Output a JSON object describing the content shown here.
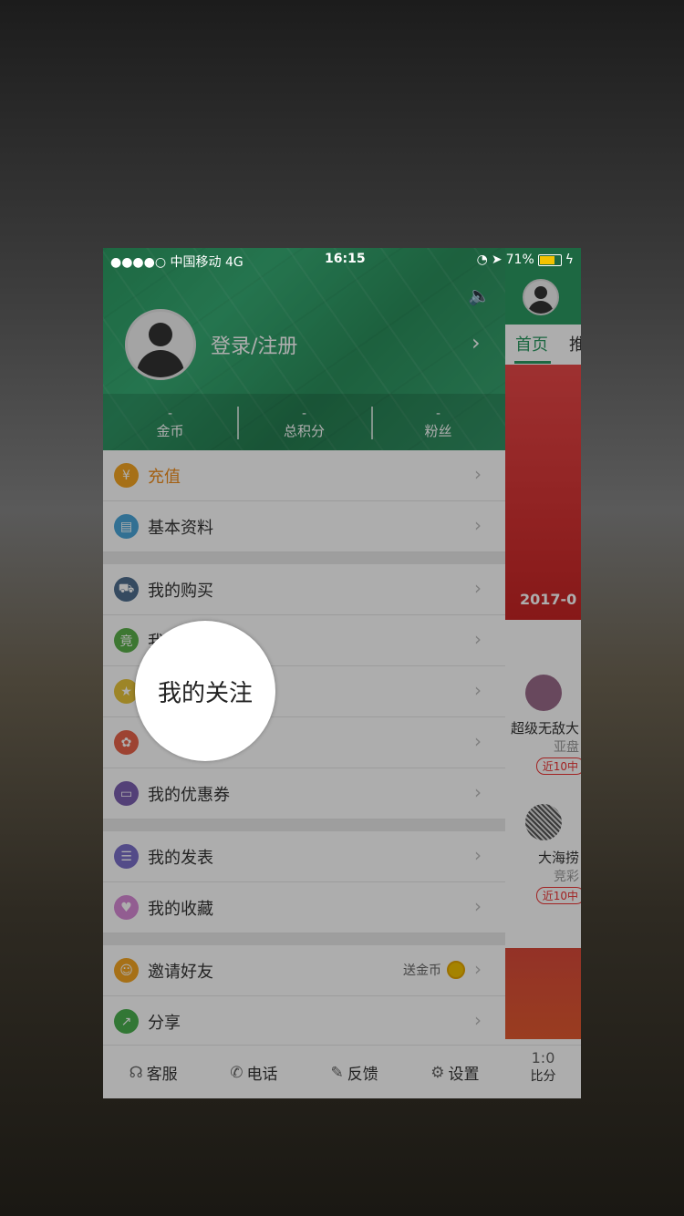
{
  "status_bar": {
    "carrier": "●●●●○ 中国移动 4G",
    "time": "16:15",
    "battery": "71%"
  },
  "drawer": {
    "login_label": "登录/注册",
    "stats": [
      {
        "value": "-",
        "label": "金币"
      },
      {
        "value": "-",
        "label": "总积分"
      },
      {
        "value": "-",
        "label": "粉丝"
      }
    ],
    "groups": [
      [
        {
          "label": "充值",
          "icon": "yen-icon",
          "color": "#f5a623"
        },
        {
          "label": "基本资料",
          "icon": "profile-card-icon",
          "color": "#4aa6d9"
        }
      ],
      [
        {
          "label": "我的购买",
          "icon": "cart-icon",
          "color": "#4f6e8e"
        },
        {
          "label": "我",
          "icon": "ticket-icon",
          "color": "#5ab04a"
        },
        {
          "label": "",
          "icon": "star-icon",
          "color": "#e8c53a"
        },
        {
          "label": "",
          "icon": "gift-icon",
          "color": "#e8644b"
        },
        {
          "label": "我的优惠券",
          "icon": "coupon-icon",
          "color": "#7b5fb0"
        }
      ],
      [
        {
          "label": "我的发表",
          "icon": "post-icon",
          "color": "#7b6fc9"
        },
        {
          "label": "我的收藏",
          "icon": "heart-icon",
          "color": "#d78ad6"
        }
      ],
      [
        {
          "label": "邀请好友",
          "icon": "invite-icon",
          "color": "#f5a623",
          "extra": "送金币"
        },
        {
          "label": "分享",
          "icon": "share-icon",
          "color": "#4ab04f"
        }
      ]
    ],
    "bottom": [
      {
        "label": "客服",
        "icon": "headset-icon"
      },
      {
        "label": "电话",
        "icon": "phone-icon"
      },
      {
        "label": "反馈",
        "icon": "edit-icon"
      },
      {
        "label": "设置",
        "icon": "gear-icon"
      }
    ]
  },
  "strip": {
    "tab_home": "首页",
    "tab_next": "推",
    "banner_date": "2017-0",
    "cards": [
      {
        "name": "超级无敌大",
        "sub": "亚盘",
        "badge": "近10中"
      },
      {
        "name": "大海捞",
        "sub": "竞彩",
        "badge": "近10中"
      }
    ],
    "bottom_tab": "比分",
    "bottom_icon": "1:0"
  },
  "spotlight": {
    "label": "我的关注"
  }
}
